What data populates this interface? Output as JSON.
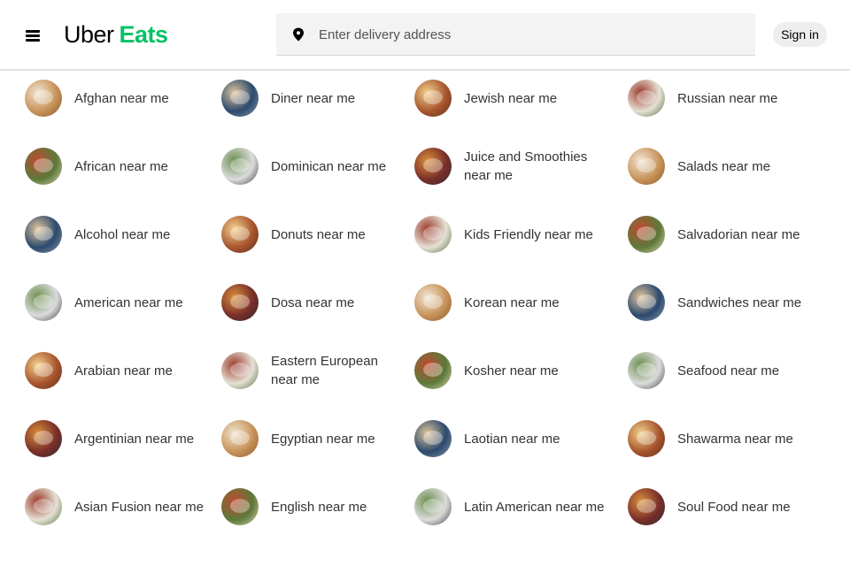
{
  "header": {
    "logo_uber": "Uber",
    "logo_eats": "Eats",
    "search_placeholder": "Enter delivery address",
    "signin_label": "Sign in"
  },
  "colors": {
    "brand_green": "#06c167",
    "search_bg": "#f3f3f3",
    "signin_bg": "#eeeeee"
  },
  "icons": {
    "menu": "hamburger-menu-icon",
    "location": "map-pin-icon"
  },
  "categories": {
    "col0": [
      "Afghan near me",
      "African near me",
      "Alcohol near me",
      "American near me",
      "Arabian near me",
      "Argentinian near me",
      "Asian Fusion near me"
    ],
    "col1": [
      "Diner near me",
      "Dominican near me",
      "Donuts near me",
      "Dosa near me",
      "Eastern European near me",
      "Egyptian near me",
      "English near me"
    ],
    "col2": [
      "Jewish near me",
      "Juice and Smoothies near me",
      "Kids Friendly near me",
      "Korean near me",
      "Kosher near me",
      "Laotian near me",
      "Latin American near me"
    ],
    "col3": [
      "Russian near me",
      "Salads near me",
      "Salvadorian near me",
      "Sandwiches near me",
      "Seafood near me",
      "Shawarma near me",
      "Soul Food near me"
    ]
  }
}
